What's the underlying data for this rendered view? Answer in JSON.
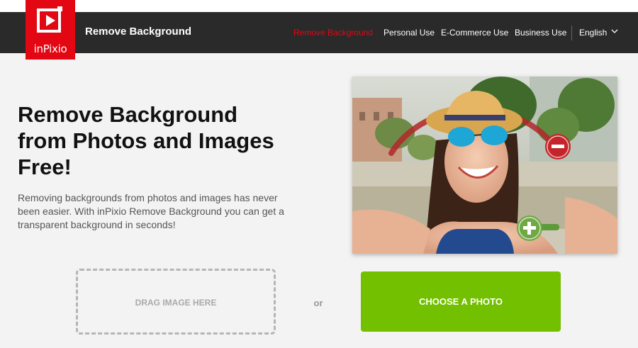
{
  "brand": {
    "logo_text": "inPixio",
    "site_title": "Remove Background",
    "colors": {
      "brand_red": "#e30613",
      "nav_bg": "#2a2a2a",
      "cta_green": "#72c000"
    }
  },
  "nav": {
    "items": [
      {
        "label": "Remove Background",
        "active": true
      },
      {
        "label": "Personal Use"
      },
      {
        "label": "E-Commerce Use"
      },
      {
        "label": "Business Use"
      }
    ],
    "language": "English",
    "language_icon": "chevron-down-icon"
  },
  "hero": {
    "headline_lines": [
      "Remove Background",
      "from Photos and Images",
      "Free!"
    ],
    "subtext": "Removing backgrounds from photos and images has never been easier. With inPixio Remove Background you can get a transparent background in seconds!",
    "image_icons": [
      "minus-icon",
      "plus-icon"
    ]
  },
  "upload": {
    "drop_label": "DRAG IMAGE HERE",
    "or_label": "or",
    "choose_label": "CHOOSE A PHOTO"
  }
}
